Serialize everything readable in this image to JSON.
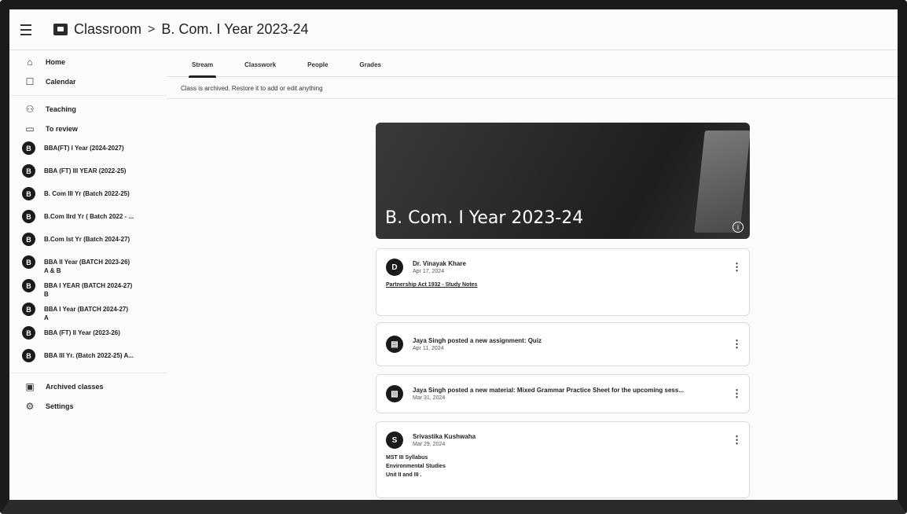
{
  "header": {
    "app_name": "Classroom",
    "separator": ">",
    "class_title": "B. Com. I Year 2023-24"
  },
  "sidebar": {
    "top_items": [
      {
        "label": "Home",
        "icon": "home-icon"
      },
      {
        "label": "Calendar",
        "icon": "calendar-icon"
      }
    ],
    "teaching": {
      "label": "Teaching",
      "icon": "people-icon"
    },
    "to_review": {
      "label": "To review",
      "icon": "folder-icon"
    },
    "classes": [
      {
        "initial": "B",
        "name": "BBA(FT) I Year (2024-2027)"
      },
      {
        "initial": "B",
        "name": "BBA (FT) III YEAR (2022-25)"
      },
      {
        "initial": "B",
        "name": "B. Com III Yr (Batch 2022-25)"
      },
      {
        "initial": "B",
        "name": "B.Com IIrd Yr ( Batch 2022 - ..."
      },
      {
        "initial": "B",
        "name": "B.Com Ist Yr (Batch 2024-27)"
      },
      {
        "initial": "B",
        "name": "BBA II Year (BATCH 2023-26)\nA & B"
      },
      {
        "initial": "B",
        "name": "BBA I YEAR (BATCH 2024-27)\nB"
      },
      {
        "initial": "B",
        "name": "BBA I Year (BATCH 2024-27)\nA"
      },
      {
        "initial": "B",
        "name": "BBA (FT) II Year (2023-26)"
      },
      {
        "initial": "B",
        "name": "BBA III Yr. (Batch 2022-25) A..."
      }
    ],
    "archived": {
      "label": "Archived classes",
      "icon": "archive-icon"
    },
    "settings": {
      "label": "Settings",
      "icon": "gear-icon"
    }
  },
  "tabs": [
    "Stream",
    "Classwork",
    "People",
    "Grades"
  ],
  "notice": "Class is archived. Restore it to add or edit anything",
  "banner": {
    "title": "B. Com. I Year 2023-24",
    "info_icon": "info-icon"
  },
  "posts": [
    {
      "avatar": "D",
      "author": "Dr. Vinayak Khare",
      "date": "Apr 17, 2024",
      "body": "Partnership Act 1932 - Study Notes"
    },
    {
      "avatar": "assignment-icon",
      "author": "Jaya Singh posted a new assignment: Quiz",
      "date": "Apr 11, 2024",
      "body": ""
    },
    {
      "avatar": "material-icon",
      "author": "Jaya Singh posted a new material: Mixed Grammar Practice Sheet for the upcoming sess...",
      "date": "Mar 31, 2024",
      "body": ""
    },
    {
      "avatar": "S",
      "author": "Srivastika Kushwaha",
      "date": "Mar 29, 2024",
      "body_lines": [
        "MST III Syllabus",
        "Environmental Studies",
        "Unit II and III ."
      ]
    }
  ]
}
